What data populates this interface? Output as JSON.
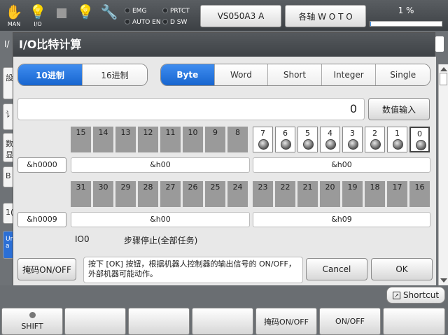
{
  "topbar": {
    "icons": [
      {
        "icon": "hand-icon",
        "label": "MAN"
      },
      {
        "icon": "lightbulb-io-icon",
        "label": "I/O"
      },
      {
        "icon": "stop-square-icon",
        "label": ""
      },
      {
        "icon": "lightbulb-icon",
        "label": ""
      },
      {
        "icon": "wrench-icon",
        "label": ""
      }
    ],
    "indicators": [
      "EMG",
      "PRTCT",
      "AUTO EN",
      "D SW"
    ],
    "robot_button": "VS050A3 A",
    "axis_button": "各轴  W O T O",
    "speed_text": "1 %",
    "speed_value": 1
  },
  "background": {
    "label": "I/",
    "tabs": [
      "設",
      "讠",
      "数显",
      "B",
      "1(",
      "Un a"
    ]
  },
  "dialog": {
    "title": "I/O比特计算",
    "radix_tabs": [
      {
        "label": "10进制",
        "active": true
      },
      {
        "label": "16进制",
        "active": false
      }
    ],
    "type_tabs": [
      {
        "label": "Byte",
        "active": true
      },
      {
        "label": "Word",
        "active": false
      },
      {
        "label": "Short",
        "active": false
      },
      {
        "label": "Integer",
        "active": false
      },
      {
        "label": "Single",
        "active": false
      }
    ],
    "value": "0",
    "input_button": "数值输入",
    "row1": {
      "address": "&h0000",
      "bits_high": [
        "15",
        "14",
        "13",
        "12",
        "11",
        "10",
        "9",
        "8"
      ],
      "bits_low": [
        "7",
        "6",
        "5",
        "4",
        "3",
        "2",
        "1",
        "0"
      ],
      "hex_high": "&h00",
      "hex_low": "&h00"
    },
    "row2": {
      "address": "&h0009",
      "bits_high": [
        "31",
        "30",
        "29",
        "28",
        "27",
        "26",
        "25",
        "24"
      ],
      "bits_low": [
        "23",
        "22",
        "21",
        "20",
        "19",
        "18",
        "17",
        "16"
      ],
      "hex_high": "&h00",
      "hex_low": "&h09"
    },
    "io_name": "IO0",
    "io_status": "步骤停止(全部任务)",
    "mask_button": "掩码ON/OFF",
    "message": "按下 [OK] 按钮，根据机器人控制器的输出信号的 ON/OFF，外部机器可能动作。",
    "cancel_button": "Cancel",
    "ok_button": "OK"
  },
  "bottom": {
    "shortcut": "Shortcut",
    "fkeys": [
      "SHIFT",
      "",
      "",
      "",
      "掩码ON/OFF",
      "ON/OFF",
      ""
    ]
  },
  "colors": {
    "accent": "#1f74e0",
    "speed_fill": "#3a8ee6",
    "bit_off": "#9a9a9a",
    "title_bar": "#45494d"
  }
}
